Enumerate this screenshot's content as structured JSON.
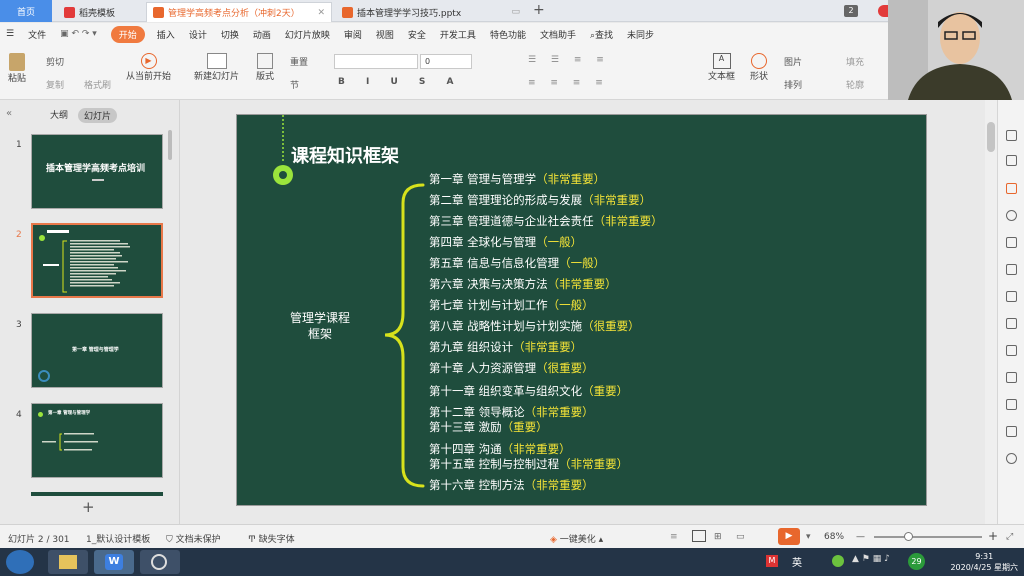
{
  "tabs": {
    "home": "首页",
    "t1": "稻壳模板",
    "t2": "管理学高频考点分析（冲刺2天）",
    "t3": "插本管理学学习技巧.pptx",
    "count": "2"
  },
  "menu": [
    "文件",
    "开始",
    "插入",
    "设计",
    "切换",
    "动画",
    "幻灯片放映",
    "审阅",
    "视图",
    "安全",
    "开发工具",
    "特色功能",
    "文档助手",
    "查找",
    "未同步"
  ],
  "ribbon": {
    "paste": "粘贴",
    "cut": "剪切",
    "copy": "复制",
    "format": "格式刷",
    "from_current": "从当前开始",
    "new_slide": "新建幻灯片",
    "layout": "版式",
    "reset": "重置",
    "section": "节",
    "font_size": "0",
    "textbox": "文本框",
    "shape": "形状",
    "picture": "图片",
    "arrange": "排列",
    "fill": "填充",
    "outline": "轮廓"
  },
  "left_panel": {
    "outline_tab": "大纲",
    "slides_tab": "幻灯片",
    "thumb1_title": "插本管理学高频考点培训",
    "thumb3_title": "第一章 管理与管理学",
    "thumb4_title": "第一章 管理与管理学"
  },
  "slide": {
    "title": "课程知识框架",
    "center_line1": "管理学课程",
    "center_line2": "框架",
    "chapters": [
      {
        "name": "第一章  管理与管理学",
        "tag": "（非常重要）"
      },
      {
        "name": "第二章  管理理论的形成与发展",
        "tag": "（非常重要）"
      },
      {
        "name": "第三章  管理道德与企业社会责任",
        "tag": "（非常重要）"
      },
      {
        "name": "第四章  全球化与管理",
        "tag": "（一般）"
      },
      {
        "name": "第五章  信息与信息化管理",
        "tag": "（一般）"
      },
      {
        "name": "第六章  决策与决策方法",
        "tag": "（非常重要）"
      },
      {
        "name": "第七章  计划与计划工作",
        "tag": "（一般）"
      },
      {
        "name": "第八章  战略性计划与计划实施",
        "tag": "（很重要）"
      },
      {
        "name": "第九章  组织设计",
        "tag": "（非常重要）"
      },
      {
        "name": "第十章  人力资源管理",
        "tag": "（很重要）"
      },
      {
        "name": "第十一章  组织变革与组织文化",
        "tag": "（重要）"
      },
      {
        "name": "第十二章  领导概论",
        "tag": "（非常重要）"
      },
      {
        "name": "第十三章  激励",
        "tag": "（重要）"
      },
      {
        "name": "第十四章  沟通",
        "tag": "（非常重要）"
      },
      {
        "name": "第十五章  控制与控制过程",
        "tag": "（非常重要）"
      },
      {
        "name": "第十六章  控制方法",
        "tag": "（非常重要）"
      }
    ]
  },
  "status": {
    "slide_no": "幻灯片 2 / 301",
    "template": "1_默认设计模板",
    "protect": "文档未保护",
    "font": "缺失字体",
    "beautify": "一键美化",
    "zoom": "68%"
  },
  "taskbar": {
    "time": "9:31",
    "date": "2020/4/25 星期六",
    "ime": "英",
    "notify": "29"
  },
  "colors": {
    "slide_bg": "#1f4d3d",
    "bracket": "#d7e21c",
    "important": "#f5e437",
    "accent": "#f07a3f"
  }
}
